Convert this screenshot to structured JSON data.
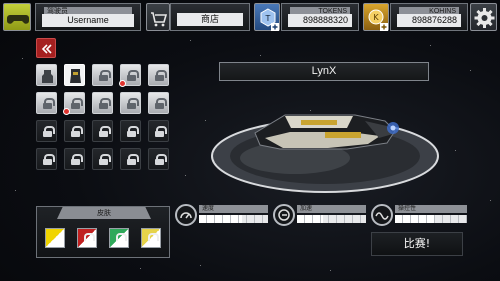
{
  "header": {
    "pilot_caption": "驾驶员",
    "username": "Username",
    "shop_label": "商店",
    "tokens_caption": "TOKENS",
    "tokens_value": "898888320",
    "kohins_caption": "KOHINS",
    "kohins_value": "898876288"
  },
  "ship": {
    "name": "LynX"
  },
  "skins_panel": {
    "title": "皮肤",
    "skin_colors": [
      "#f0d400",
      "#c02020",
      "#2fa85a",
      "#e6d34a"
    ]
  },
  "stats": [
    {
      "label": "速度",
      "icon": "speedometer-icon",
      "level": 0.62
    },
    {
      "label": "加速",
      "icon": "acceleration-icon",
      "level": 0.38
    },
    {
      "label": "操控性",
      "icon": "handling-icon",
      "level": 0.55
    }
  ],
  "race_label": "比赛!",
  "icons": {
    "controller": "gamepad-icon",
    "shop": "cart-icon",
    "tokens": "token-icon",
    "kohins": "coin-icon",
    "settings": "gear-icon",
    "back": "double-chevron-left-icon"
  },
  "accent": "#a52020"
}
